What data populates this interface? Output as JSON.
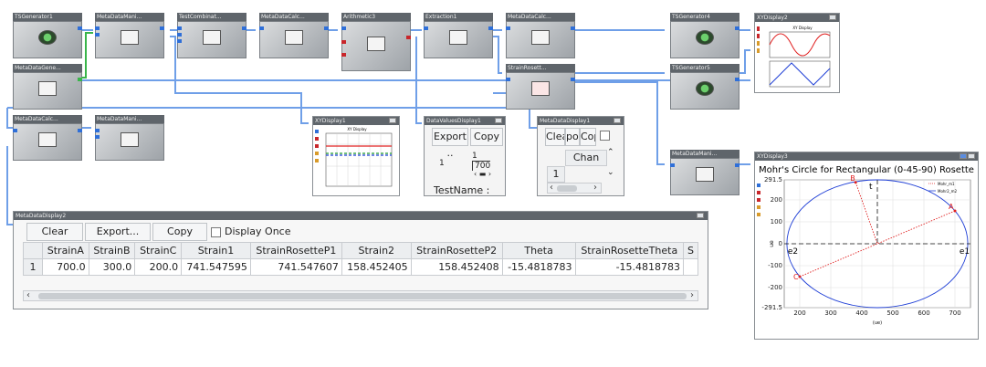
{
  "nodes": {
    "tsgen1": "TSGenerator1",
    "mdman1": "MetaDataMani...",
    "testcomb": "TestCombinat...",
    "mdcalc1": "MetaDataCalc...",
    "arith3": "Arithmetic3",
    "extract1": "Extraction1",
    "mdcalc2": "MetaDataCalc...",
    "tsgen4": "TSGenerator4",
    "mdgen": "MetaDataGene...",
    "strainros": "StrainRosett...",
    "tsgen5": "TSGenerator5",
    "mdcalc3": "MetaDataCalc...",
    "mdman2": "MetaDataMani...",
    "mdman3": "MetaDataMani..."
  },
  "xy_display2": {
    "title": "XYDisplay2",
    "inner_title": "XY Display"
  },
  "xy_display1": {
    "title": "XYDisplay1",
    "inner_title": "XY Display"
  },
  "data_values_display1": {
    "title": "DataValuesDisplay1",
    "export_label": "Export ..",
    "copy_label": "Copy",
    "cell_a": "1",
    "cell_b": "1",
    "cell_c": "700",
    "testname_label": "TestName :"
  },
  "metadata_display1": {
    "title": "MetaDataDisplay1",
    "clear_label": "Clea",
    "export_label": "por",
    "copy_label": "Cop",
    "column_label": "Chan",
    "row_number": "1"
  },
  "metadata_display2": {
    "title": "MetaDataDisplay2",
    "clear_label": "Clear",
    "export_label": "Export...",
    "copy_label": "Copy",
    "display_once_label": "Display Once",
    "columns": [
      "StrainA",
      "StrainB",
      "StrainC",
      "Strain1",
      "StrainRosetteP1",
      "Strain2",
      "StrainRosetteP2",
      "Theta",
      "StrainRosetteTheta",
      "S"
    ],
    "rows": [
      {
        "index": "1",
        "cells": [
          "700.0",
          "300.0",
          "200.0",
          "741.547595",
          "741.547607",
          "158.452405",
          "158.452408",
          "-15.4818783",
          "-15.4818783",
          ""
        ]
      }
    ]
  },
  "xy_display3": {
    "title": "XYDisplay3",
    "chart_title": "Mohr's Circle for Rectangular (0-45-90) Rosette",
    "legend": [
      "Mohr_m1",
      "Mohr2_m2"
    ],
    "point_labels": {
      "A": "A",
      "B": "B",
      "C": "C",
      "e1": "e1",
      "e2": "e2",
      "t": "t"
    },
    "x_unit": "(ue)",
    "y_unit": "ue"
  },
  "chart_data": {
    "type": "scatter",
    "title": "Mohr's Circle for Rectangular (0-45-90) Rosette",
    "xlabel": "(ue)",
    "ylabel": "ue",
    "xlim": [
      150,
      750
    ],
    "ylim": [
      -291.5,
      291.5
    ],
    "x_ticks": [
      200,
      300,
      400,
      500,
      600,
      700
    ],
    "y_ticks": [
      -291.5,
      -200,
      -100,
      0,
      100,
      200,
      291.5
    ],
    "grid": true,
    "legend_position": "top-right",
    "circle": {
      "center_x": 450,
      "center_y": 0,
      "radius": 291.5,
      "color": "#1f3fd6"
    },
    "series": [
      {
        "name": "Mohr_m1",
        "color": "#e02020",
        "points": [
          {
            "label": "A",
            "x": 700,
            "y": 150
          },
          {
            "label": "B",
            "x": 380,
            "y": 280
          },
          {
            "label": "C",
            "x": 200,
            "y": -150
          }
        ]
      }
    ],
    "axis_labels": {
      "e1": 741.5,
      "e2": 158.5,
      "t_x": 450
    }
  },
  "colors": {
    "wire": "#6f9fe8",
    "wire_green": "#39b54a",
    "title_bar": "#5f656b",
    "node_body": "#b8bcc0"
  },
  "icons": {
    "generator": "waveform-circle-icon",
    "metadata": "document-gear-icon",
    "arithmetic": "math-operators-icon",
    "extraction": "extract-signal-icon",
    "strain": "red-strain-icon"
  }
}
